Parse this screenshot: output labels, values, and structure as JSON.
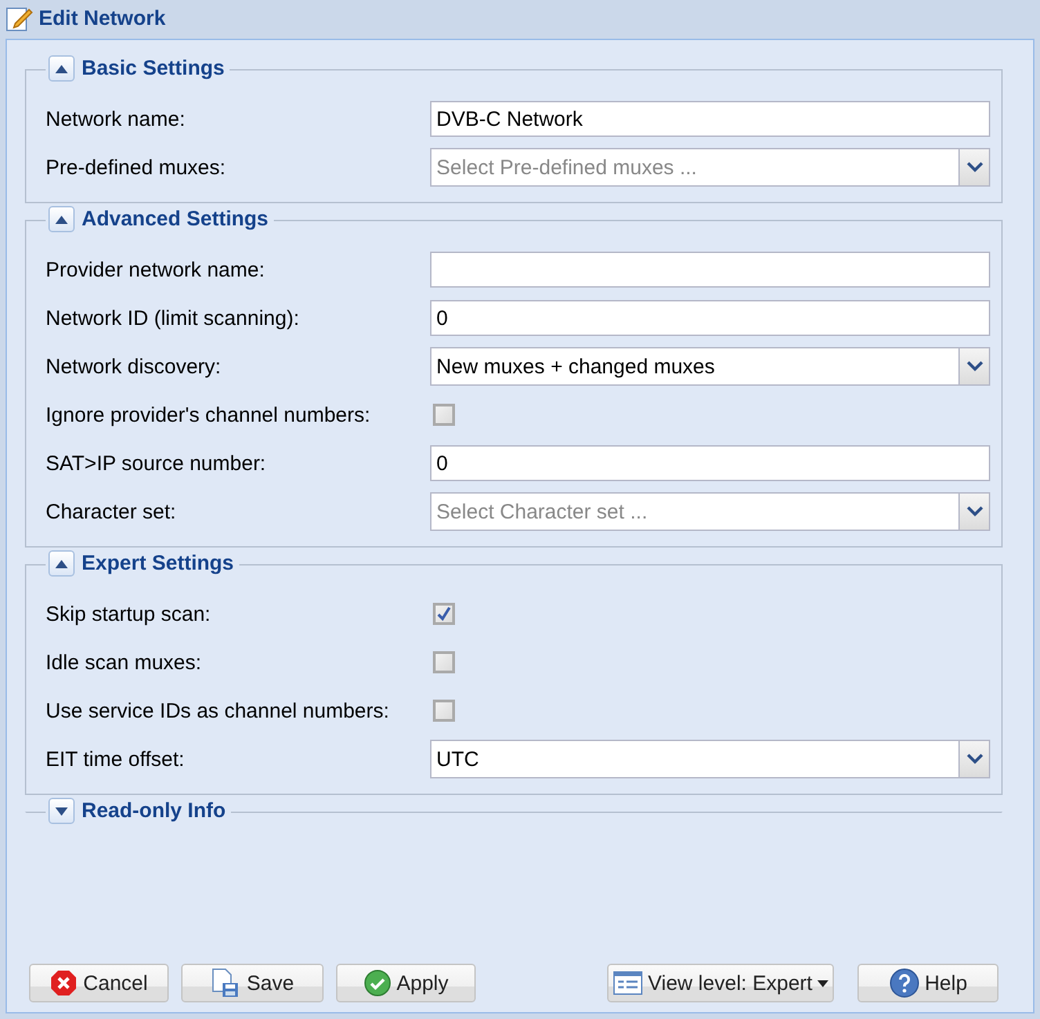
{
  "window": {
    "title": "Edit Network"
  },
  "sections": [
    {
      "title": "Basic Settings",
      "expanded": true,
      "fields": [
        {
          "label": "Network name:",
          "kind": "text",
          "value": "DVB-C Network"
        },
        {
          "label": "Pre-defined muxes:",
          "kind": "combo",
          "placeholder": "Select Pre-defined muxes ..."
        }
      ]
    },
    {
      "title": "Advanced Settings",
      "expanded": true,
      "fields": [
        {
          "label": "Provider network name:",
          "kind": "text"
        },
        {
          "label": "Network ID (limit scanning):",
          "kind": "text",
          "value": "0"
        },
        {
          "label": "Network discovery:",
          "kind": "combo",
          "value": "New muxes + changed muxes"
        },
        {
          "label": "Ignore provider's channel numbers:",
          "kind": "checkbox",
          "checked": false
        },
        {
          "label": "SAT>IP source number:",
          "kind": "text",
          "value": "0"
        },
        {
          "label": "Character set:",
          "kind": "combo",
          "placeholder": "Select Character set ..."
        }
      ]
    },
    {
      "title": "Expert Settings",
      "expanded": true,
      "fields": [
        {
          "label": "Skip startup scan:",
          "kind": "checkbox",
          "checked": true
        },
        {
          "label": "Idle scan muxes:",
          "kind": "checkbox",
          "checked": false
        },
        {
          "label": "Use service IDs as channel numbers:",
          "kind": "checkbox",
          "checked": false
        },
        {
          "label": "EIT time offset:",
          "kind": "combo",
          "value": "UTC"
        }
      ]
    },
    {
      "title": "Read-only Info",
      "expanded": false
    }
  ],
  "buttons": [
    {
      "label": "Cancel",
      "kind": "cancel"
    },
    {
      "label": "Save",
      "kind": "save"
    },
    {
      "label": "Apply",
      "kind": "apply"
    },
    {
      "label": "View level: Expert",
      "kind": "view"
    },
    {
      "label": "Help",
      "kind": "help"
    }
  ]
}
